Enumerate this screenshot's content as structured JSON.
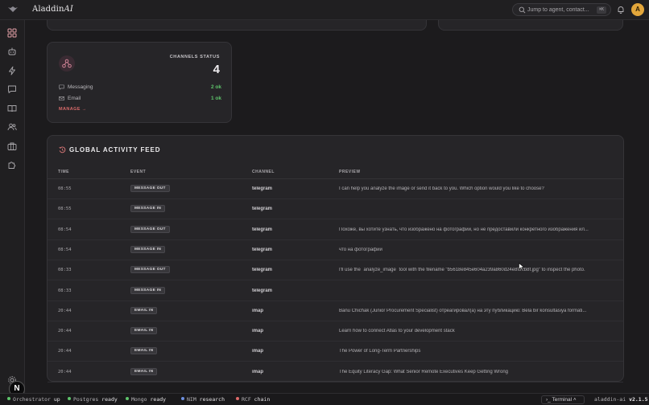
{
  "app": {
    "brand_main": "Aladdin",
    "brand_ai": "AI"
  },
  "search": {
    "placeholder": "Jump to agent, contact...",
    "shortcut": "⌘K"
  },
  "user": {
    "avatar_initial": "A"
  },
  "colors": {
    "accent": "#e2a63b",
    "ok": "#5ec46b",
    "manage": "#d86a6a"
  },
  "sidebar": {
    "items": [
      {
        "icon": "dashboard-icon",
        "active": true
      },
      {
        "icon": "robot-icon"
      },
      {
        "icon": "lightning-icon"
      },
      {
        "icon": "chat-icon"
      },
      {
        "icon": "book-icon"
      },
      {
        "icon": "users-icon"
      },
      {
        "icon": "briefcase-icon"
      },
      {
        "icon": "puzzle-icon"
      },
      {
        "icon": "gear-icon"
      }
    ]
  },
  "channels": {
    "label": "CHANNELS STATUS",
    "count": "4",
    "rows": [
      {
        "icon": "message-icon",
        "name": "Messaging",
        "value": "2 ok"
      },
      {
        "icon": "mail-icon",
        "name": "Email",
        "value": "1 ok"
      }
    ],
    "manage": "MANAGE →"
  },
  "feed": {
    "title": "GLOBAL ACTIVITY FEED",
    "columns": {
      "time": "TIME",
      "event": "EVENT",
      "channel": "CHANNEL",
      "preview": "PREVIEW"
    },
    "rows": [
      {
        "time": "08:55",
        "event": "MESSAGE OUT",
        "channel": "telegram",
        "preview": "I can help you analyze the image or send it back to you. Which option would you like to choose?"
      },
      {
        "time": "08:55",
        "event": "MESSAGE IN",
        "channel": "telegram",
        "preview": ""
      },
      {
        "time": "08:54",
        "event": "MESSAGE OUT",
        "channel": "telegram",
        "preview": "Похоже, вы хотите узнать, что изображено на фотографии, но не предоставили конкретного изображения ил..."
      },
      {
        "time": "08:54",
        "event": "MESSAGE IN",
        "channel": "telegram",
        "preview": "что на фотографии"
      },
      {
        "time": "08:33",
        "event": "MESSAGE OUT",
        "channel": "telegram",
        "preview": "I'll use the `analyze_image` tool with the filename \"b5618e845e604a239a860d24e8f82b8f.jpg\" to inspect the photo."
      },
      {
        "time": "08:33",
        "event": "MESSAGE IN",
        "channel": "telegram",
        "preview": ""
      },
      {
        "time": "20:44",
        "event": "EMAIL IN",
        "channel": "imap",
        "preview": "Banu Chichak (Junior Procurement Specialist) отреагировал(а) на эту публикацию: Bela bir konsultasiya formati..."
      },
      {
        "time": "20:44",
        "event": "EMAIL IN",
        "channel": "imap",
        "preview": "Learn how to connect Atlas to your development stack"
      },
      {
        "time": "20:44",
        "event": "EMAIL IN",
        "channel": "imap",
        "preview": "The Power of Long-Term Partnerships"
      },
      {
        "time": "20:44",
        "event": "EMAIL IN",
        "channel": "imap",
        "preview": "The Equity Literacy Gap: What Senior Remote Executives Keep Getting Wrong"
      }
    ]
  },
  "statusbar": {
    "items": [
      {
        "name": "Orchestrator",
        "state": "up",
        "color": "#5ec46b"
      },
      {
        "name": "Postgres",
        "state": "ready",
        "color": "#5ec46b"
      },
      {
        "name": "Mongo",
        "state": "ready",
        "color": "#5ec46b"
      },
      {
        "name": "NIM",
        "state": "research",
        "color": "#6d8fe0"
      },
      {
        "name": "RCF",
        "state": "chain",
        "color": "#e06a6a"
      }
    ],
    "terminal": "Terminal",
    "version_name": "aladdin-ai",
    "version": "v2.1.5"
  },
  "overlay": {
    "badge": "N"
  }
}
